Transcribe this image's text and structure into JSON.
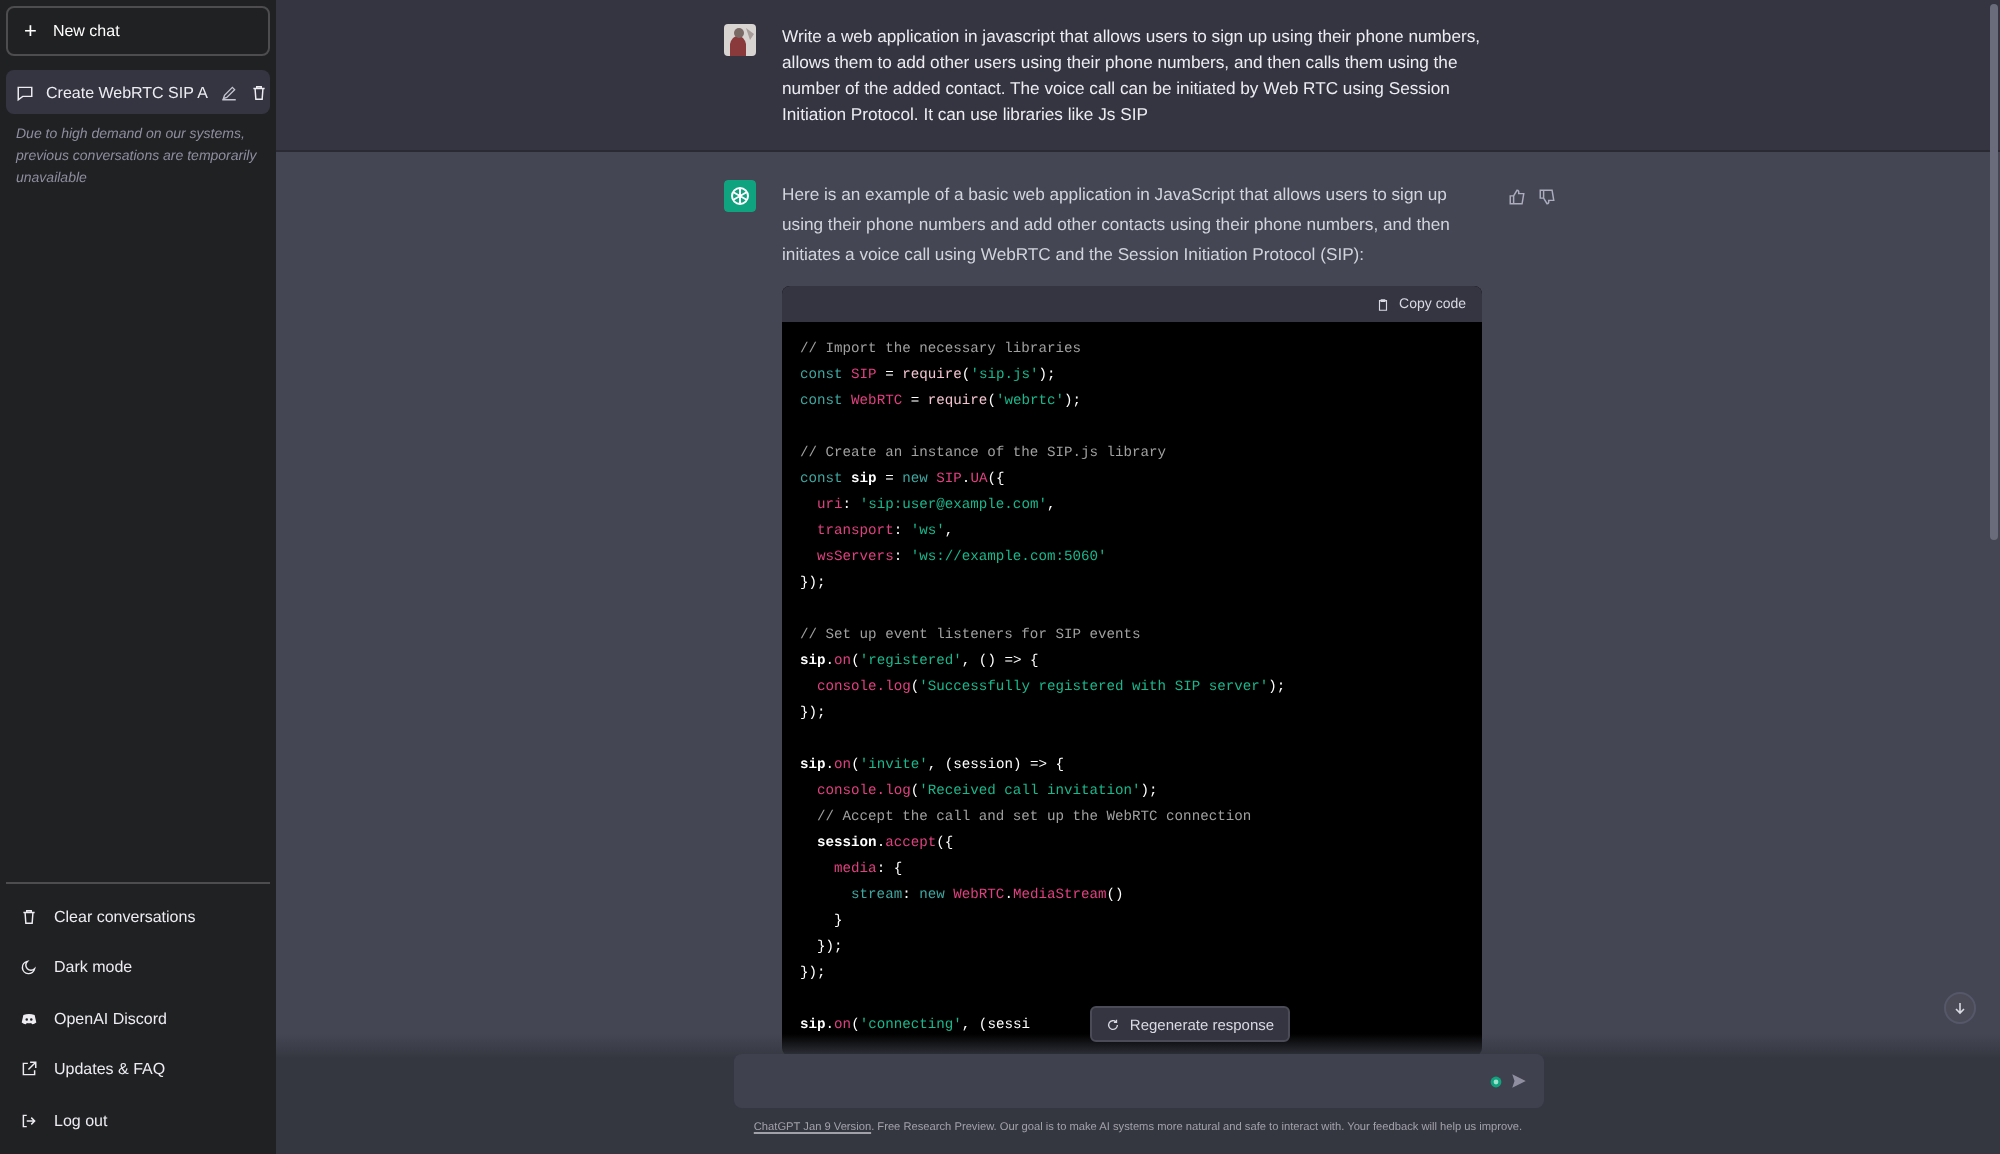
{
  "sidebar": {
    "new_chat": {
      "icon": "+",
      "label": "New chat"
    },
    "conversations": [
      {
        "title": "Create WebRTC SIP A",
        "selected": true
      }
    ],
    "notice": "Due to high demand on our systems, previous conversations are temporarily unavailable",
    "menu": [
      {
        "kind": "trash",
        "label": "Clear conversations"
      },
      {
        "kind": "moon",
        "label": "Dark mode"
      },
      {
        "kind": "discord",
        "label": "OpenAI Discord"
      },
      {
        "kind": "external",
        "label": "Updates & FAQ"
      },
      {
        "kind": "logout",
        "label": "Log out"
      }
    ]
  },
  "prompt": {
    "text": "Write a web application in javascript that allows users to sign up using their phone numbers, allows them to add other users using their phone numbers, and then calls them using the number of the added contact. The voice call can be initiated by Web RTC using Session Initiation Protocol. It can use libraries like Js SIP"
  },
  "reply": {
    "text": "Here is an example of a basic web application in JavaScript that allows users to sign up using their phone numbers and add other contacts using their phone numbers, and then initiates a voice call using WebRTC and the Session Initiation Protocol (SIP):",
    "code": {
      "copy_label": "Copy code",
      "blocks": [
        {
          "lines": [
            {
              "tokens": [
                {
                  "kind": "comment",
                  "text": "// Import the necessary libraries"
                }
              ]
            },
            {
              "tokens": [
                {
                  "kind": "keyword",
                  "text": "const "
                },
                {
                  "kind": "name",
                  "text": "SIP"
                },
                {
                  "kind": "plain",
                  "text": " = "
                },
                {
                  "kind": "call",
                  "text": "require"
                },
                {
                  "kind": "plain",
                  "text": "("
                },
                {
                  "kind": "string",
                  "text": "'sip.js'"
                },
                {
                  "kind": "plain",
                  "text": ");"
                }
              ]
            },
            {
              "tokens": [
                {
                  "kind": "keyword",
                  "text": "const "
                },
                {
                  "kind": "name",
                  "text": "WebRTC"
                },
                {
                  "kind": "plain",
                  "text": " = "
                },
                {
                  "kind": "call",
                  "text": "require"
                },
                {
                  "kind": "plain",
                  "text": "("
                },
                {
                  "kind": "string",
                  "text": "'webrtc'"
                },
                {
                  "kind": "plain",
                  "text": ");"
                }
              ]
            }
          ]
        },
        {
          "lines": [
            {
              "tokens": [
                {
                  "kind": "comment",
                  "text": "// Create an instance of the SIP.js library"
                }
              ]
            },
            {
              "tokens": [
                {
                  "kind": "keyword",
                  "text": "const "
                },
                {
                  "kind": "ident",
                  "text": "sip"
                },
                {
                  "kind": "plain",
                  "text": " = "
                },
                {
                  "kind": "keyword",
                  "text": "new "
                },
                {
                  "kind": "name",
                  "text": "SIP"
                },
                {
                  "kind": "plain",
                  "text": "."
                },
                {
                  "kind": "name",
                  "text": "UA"
                },
                {
                  "kind": "plain",
                  "text": "({"
                }
              ]
            },
            {
              "tokens": [
                {
                  "kind": "name",
                  "text": "  uri"
                },
                {
                  "kind": "plain",
                  "text": ": "
                },
                {
                  "kind": "string",
                  "text": "'sip:user@example.com'"
                },
                {
                  "kind": "plain",
                  "text": ","
                }
              ]
            },
            {
              "tokens": [
                {
                  "kind": "name",
                  "text": "  transport"
                },
                {
                  "kind": "plain",
                  "text": ": "
                },
                {
                  "kind": "string",
                  "text": "'ws'"
                },
                {
                  "kind": "plain",
                  "text": ","
                }
              ]
            },
            {
              "tokens": [
                {
                  "kind": "name",
                  "text": "  wsServers"
                },
                {
                  "kind": "plain",
                  "text": ": "
                },
                {
                  "kind": "string",
                  "text": "'ws://example.com:5060'"
                }
              ]
            },
            {
              "tokens": [
                {
                  "kind": "plain",
                  "text": "});"
                }
              ]
            }
          ]
        },
        {
          "lines": [
            {
              "tokens": [
                {
                  "kind": "comment",
                  "text": "// Set up event listeners for SIP events"
                }
              ]
            },
            {
              "tokens": [
                {
                  "kind": "ident",
                  "text": "sip"
                },
                {
                  "kind": "plain",
                  "text": "."
                },
                {
                  "kind": "name",
                  "text": "on"
                },
                {
                  "kind": "plain",
                  "text": "("
                },
                {
                  "kind": "string",
                  "text": "'registered'"
                },
                {
                  "kind": "plain",
                  "text": ", () => {"
                }
              ]
            },
            {
              "tokens": [
                {
                  "kind": "name",
                  "text": "  console.log"
                },
                {
                  "kind": "plain",
                  "text": "("
                },
                {
                  "kind": "string",
                  "text": "'Successfully registered with SIP server'"
                },
                {
                  "kind": "plain",
                  "text": ");"
                }
              ]
            },
            {
              "tokens": [
                {
                  "kind": "plain",
                  "text": "});"
                }
              ]
            }
          ]
        },
        {
          "lines": [
            {
              "tokens": [
                {
                  "kind": "ident",
                  "text": "sip"
                },
                {
                  "kind": "plain",
                  "text": "."
                },
                {
                  "kind": "name",
                  "text": "on"
                },
                {
                  "kind": "plain",
                  "text": "("
                },
                {
                  "kind": "string",
                  "text": "'invite'"
                },
                {
                  "kind": "plain",
                  "text": ", (session) => {"
                }
              ]
            },
            {
              "tokens": [
                {
                  "kind": "name",
                  "text": "  console.log"
                },
                {
                  "kind": "plain",
                  "text": "("
                },
                {
                  "kind": "string",
                  "text": "'Received call invitation'"
                },
                {
                  "kind": "plain",
                  "text": ");"
                }
              ]
            },
            {
              "tokens": [
                {
                  "kind": "comment",
                  "text": "  // Accept the call and set up the WebRTC connection"
                }
              ]
            },
            {
              "tokens": [
                {
                  "kind": "ident",
                  "text": "  session"
                },
                {
                  "kind": "plain",
                  "text": "."
                },
                {
                  "kind": "name",
                  "text": "accept"
                },
                {
                  "kind": "plain",
                  "text": "({"
                }
              ]
            },
            {
              "tokens": [
                {
                  "kind": "name",
                  "text": "    media"
                },
                {
                  "kind": "plain",
                  "text": ": {"
                }
              ]
            },
            {
              "tokens": [
                {
                  "kind": "keyword",
                  "text": "      stream"
                },
                {
                  "kind": "plain",
                  "text": ": "
                },
                {
                  "kind": "keyword",
                  "text": "new "
                },
                {
                  "kind": "name",
                  "text": "WebRTC"
                },
                {
                  "kind": "plain",
                  "text": "."
                },
                {
                  "kind": "name",
                  "text": "MediaStream"
                },
                {
                  "kind": "plain",
                  "text": "()"
                }
              ]
            },
            {
              "tokens": [
                {
                  "kind": "plain",
                  "text": "    }"
                }
              ]
            },
            {
              "tokens": [
                {
                  "kind": "plain",
                  "text": "  });"
                }
              ]
            },
            {
              "tokens": [
                {
                  "kind": "plain",
                  "text": "});"
                }
              ]
            }
          ]
        },
        {
          "lines": [
            {
              "tokens": [
                {
                  "kind": "ident",
                  "text": "sip"
                },
                {
                  "kind": "plain",
                  "text": "."
                },
                {
                  "kind": "name",
                  "text": "on"
                },
                {
                  "kind": "plain",
                  "text": "("
                },
                {
                  "kind": "string",
                  "text": "'connecting'"
                },
                {
                  "kind": "plain",
                  "text": ", (sessi"
                }
              ]
            }
          ]
        }
      ]
    }
  },
  "regenerate_label": "Regenerate response",
  "footer": {
    "link": "ChatGPT Jan 9 Version",
    "text": ". Free Research Preview. Our goal is to make AI systems more natural and safe to interact with. Your feedback will help us improve."
  }
}
